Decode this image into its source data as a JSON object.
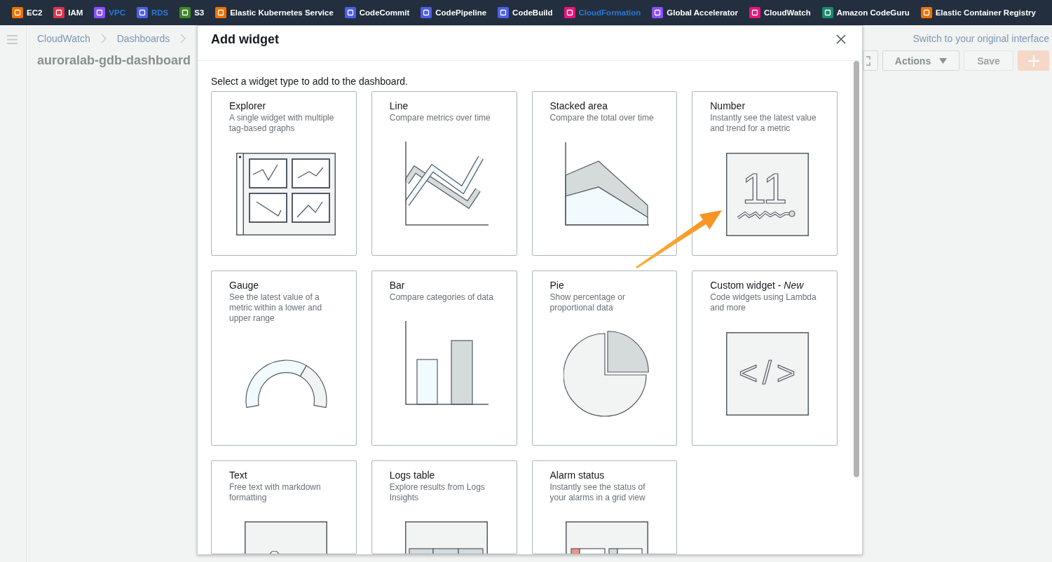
{
  "top_nav": {
    "items": [
      {
        "label": "EC2",
        "color": "#ed7100",
        "highlighted": false
      },
      {
        "label": "IAM",
        "color": "#dd344c",
        "highlighted": false
      },
      {
        "label": "VPC",
        "color": "#8c4fff",
        "highlighted": true
      },
      {
        "label": "RDS",
        "color": "#4d5fe8",
        "highlighted": true
      },
      {
        "label": "S3",
        "color": "#3f8624",
        "highlighted": false
      },
      {
        "label": "Elastic Kubernetes Service",
        "color": "#ed7100",
        "highlighted": false
      },
      {
        "label": "CodeCommit",
        "color": "#4d5fe8",
        "highlighted": false
      },
      {
        "label": "CodePipeline",
        "color": "#4d5fe8",
        "highlighted": false
      },
      {
        "label": "CodeBuild",
        "color": "#4d5fe8",
        "highlighted": false
      },
      {
        "label": "CloudFormation",
        "color": "#e7157b",
        "highlighted": true
      },
      {
        "label": "Global Accelerator",
        "color": "#8c4fff",
        "highlighted": false
      },
      {
        "label": "CloudWatch",
        "color": "#e7157b",
        "highlighted": false
      },
      {
        "label": "Amazon CodeGuru",
        "color": "#1b8a6b",
        "highlighted": false
      },
      {
        "label": "Elastic Container Registry",
        "color": "#ed7100",
        "highlighted": false
      }
    ]
  },
  "page": {
    "breadcrumbs": [
      "CloudWatch",
      "Dashboards"
    ],
    "title": "auroralab-gdb-dashboard",
    "switch_link": "Switch to your original interface",
    "buttons": [
      {
        "kind": "fullscreen",
        "disabled": false
      },
      {
        "kind": "dropdown",
        "label": "Actions",
        "disabled": false
      },
      {
        "kind": "plain",
        "label": "Save",
        "disabled": true
      },
      {
        "kind": "add",
        "disabled": false
      }
    ]
  },
  "dialog": {
    "title": "Add widget",
    "intro": "Select a widget type to add to the dashboard.",
    "widgets": [
      {
        "kind": "explorer",
        "title": "Explorer",
        "description": "A single widget with multiple\ntag-based graphs"
      },
      {
        "kind": "line",
        "title": "Line",
        "description": "Compare metrics over time"
      },
      {
        "kind": "stacked_area",
        "title": "Stacked area",
        "description": "Compare the total over time"
      },
      {
        "kind": "number",
        "title": "Number",
        "description": "Instantly see the latest value\nand trend for a metric",
        "illustration_text": "11"
      },
      {
        "kind": "gauge",
        "title": "Gauge",
        "description": "See the latest value of a\nmetric within a lower and\nupper range"
      },
      {
        "kind": "bar",
        "title": "Bar",
        "description": "Compare categories of data"
      },
      {
        "kind": "pie",
        "title": "Pie",
        "description": "Show percentage or\nproportional data"
      },
      {
        "kind": "custom",
        "title": "Custom widget - *New*",
        "description": "Code widgets using Lambda\nand more",
        "illustration_text": "</>"
      },
      {
        "kind": "text",
        "title": "Text",
        "description": "Free text with markdown\nformatting"
      },
      {
        "kind": "logs_table",
        "title": "Logs table",
        "description": "Explore results from Logs\nInsights"
      },
      {
        "kind": "alarm_status",
        "title": "Alarm status",
        "description": "Instantly see the status of\nyour alarms in a grid view"
      }
    ]
  }
}
